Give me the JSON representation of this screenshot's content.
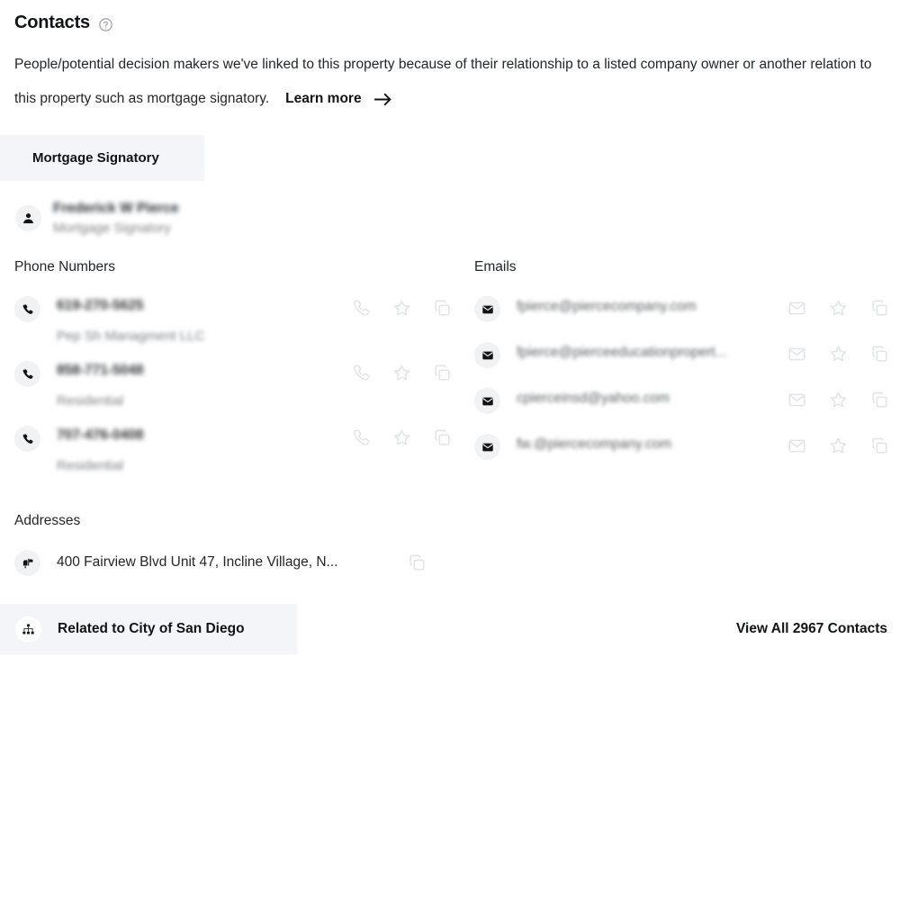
{
  "header": {
    "title": "Contacts",
    "help_icon": "question-circle-icon",
    "description": "People/potential decision makers we've linked to this property because of their relationship to a listed company owner or another relation to this property such as mortgage signatory.",
    "learn_more_label": "Learn more",
    "learn_more_icon": "arrow-right-icon"
  },
  "tabs": [
    {
      "label": "Mortgage Signatory",
      "selected": true
    }
  ],
  "contact": {
    "avatar_icon": "person-icon",
    "name": "Frederick W Pierce",
    "role": "Mortgage Signatory",
    "redacted": true
  },
  "phones": {
    "heading": "Phone Numbers",
    "items": [
      {
        "icon": "phone-icon",
        "number": "619-270-5625",
        "label": "Pep Sh Managment LLC",
        "redacted": true,
        "actions": [
          "call-icon",
          "star-icon",
          "copy-icon"
        ]
      },
      {
        "icon": "phone-icon",
        "number": "858-771-5048",
        "label": "Residential",
        "redacted": true,
        "actions": [
          "call-icon",
          "star-icon",
          "copy-icon"
        ]
      },
      {
        "icon": "phone-icon",
        "number": "707-476-0408",
        "label": "Residential",
        "redacted": true,
        "actions": [
          "call-icon",
          "star-icon",
          "copy-icon"
        ]
      }
    ]
  },
  "emails": {
    "heading": "Emails",
    "items": [
      {
        "icon": "envelope-filled-icon",
        "address": "fpierce@piercecompany.com",
        "redacted": true,
        "actions": [
          "mail-icon",
          "star-icon",
          "copy-icon"
        ]
      },
      {
        "icon": "envelope-filled-icon",
        "address": "fpierce@pierceeducationpropert...",
        "redacted": true,
        "actions": [
          "mail-icon",
          "star-icon",
          "copy-icon"
        ]
      },
      {
        "icon": "envelope-filled-icon",
        "address": "cpierceinsd@yahoo.com",
        "redacted": true,
        "actions": [
          "mail-icon",
          "star-icon",
          "copy-icon"
        ]
      },
      {
        "icon": "envelope-filled-icon",
        "address": "fw.@piercecompany.com",
        "redacted": true,
        "actions": [
          "mail-icon",
          "star-icon",
          "copy-icon"
        ]
      }
    ]
  },
  "addresses": {
    "heading": "Addresses",
    "items": [
      {
        "icon": "mailbox-icon",
        "text": "400 Fairview Blvd Unit 47, Incline Village, N...",
        "copy_icon": "copy-icon"
      }
    ]
  },
  "footer": {
    "related_icon": "hierarchy-icon",
    "related_label": "Related to City of San Diego",
    "view_all_label": "View All 2967 Contacts"
  },
  "colors": {
    "page_background": "#ffffff",
    "tab_background": "#f4f5f8",
    "icon_circle": "#f1f2f4",
    "action_icon": "#e2e4e7",
    "text_primary": "#111315",
    "text_muted": "#7b8186"
  }
}
